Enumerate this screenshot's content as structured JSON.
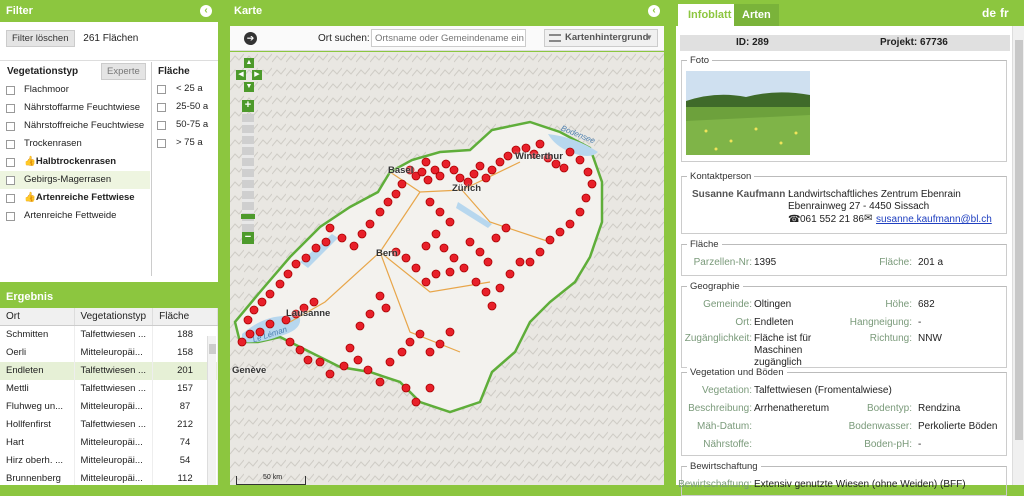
{
  "filter": {
    "title": "Filter",
    "clear_label": "Filter löschen",
    "count": "261 Flächen",
    "veg_header": "Vegetationstyp",
    "expert_label": "Experte",
    "area_header": "Fläche",
    "veg_items": [
      {
        "label": "Flachmoor"
      },
      {
        "label": "Nährstoffarme Feuchtwiese"
      },
      {
        "label": "Nährstoffreiche Feuchtwiese"
      },
      {
        "label": "Trockenrasen"
      },
      {
        "label": "Halbtrockenrasen"
      },
      {
        "label": "Gebirgs-Magerrasen"
      },
      {
        "label": "Artenreiche Fettwiese"
      },
      {
        "label": "Artenreiche Fettweide"
      }
    ],
    "area_items": [
      {
        "label": "< 25 a"
      },
      {
        "label": "25-50 a"
      },
      {
        "label": "50-75 a"
      },
      {
        "label": "> 75 a"
      }
    ]
  },
  "result": {
    "title": "Ergebnis",
    "columns": [
      "Ort",
      "Vegetationstyp",
      "Fläche"
    ],
    "rows": [
      {
        "ort": "Schmitten",
        "veg": "Talfettwiesen ...",
        "area": "188"
      },
      {
        "ort": "Oerli",
        "veg": "Mitteleuropäi...",
        "area": "158"
      },
      {
        "ort": "Endleten",
        "veg": "Talfettwiesen ...",
        "area": "201"
      },
      {
        "ort": "Mettli",
        "veg": "Talfettwiesen ...",
        "area": "157"
      },
      {
        "ort": "Fluhweg un...",
        "veg": "Mitteleuropäi...",
        "area": "87"
      },
      {
        "ort": "Hollfenfirst",
        "veg": "Talfettwiesen ...",
        "area": "212"
      },
      {
        "ort": "Hart",
        "veg": "Mitteleuropäi...",
        "area": "74"
      },
      {
        "ort": "Hirz oberh. ...",
        "veg": "Mitteleuropäi...",
        "area": "54"
      },
      {
        "ort": "Brunnenberg",
        "veg": "Mitteleuropäi...",
        "area": "112"
      }
    ]
  },
  "map": {
    "title": "Karte",
    "search_label": "Ort suchen:",
    "search_placeholder": "Ortsname oder Gemeindename ein",
    "bg_label": "Kartenhintergrund",
    "scale_label": "50 km",
    "lake_leman": "Le Léman",
    "lake_bodensee": "Bodensee",
    "cities": [
      {
        "name": "Basel"
      },
      {
        "name": "Winterthur"
      },
      {
        "name": "Zürich"
      },
      {
        "name": "Bern"
      },
      {
        "name": "Lausanne"
      },
      {
        "name": "Genève"
      }
    ]
  },
  "info": {
    "tab_info": "Infoblatt",
    "tab_species": "Arten",
    "lang_de": "de",
    "lang_fr": "fr",
    "id_label": "ID: 289",
    "project_label": "Projekt: 67736",
    "foto_title": "Foto",
    "contact_title": "Kontaktperson",
    "contact_name": "Susanne Kaufmann :",
    "contact_org": "Landwirtschaftliches Zentrum Ebenrain",
    "contact_addr": "Ebenrainweg 27 - 4450 Sissach",
    "phone": "061 552 21 86",
    "email": "susanne.kaufmann@bl.ch",
    "area_title": "Fläche",
    "parcel_label": "Parzellen-Nr:",
    "parcel_value": "1395",
    "flaeche_label": "Fläche:",
    "flaeche_value": "201 a",
    "geo_title": "Geographie",
    "gemeinde_label": "Gemeinde:",
    "gemeinde_value": "Oltingen",
    "hoehe_label": "Höhe:",
    "hoehe_value": "682",
    "ort_label": "Ort:",
    "ort_value": "Endleten",
    "neigung_label": "Hangneigung:",
    "neigung_value": "-",
    "zugang_label": "Zugänglichkeit:",
    "zugang_value": "Fläche ist für Maschinen zugänglich",
    "richtung_label": "Richtung:",
    "richtung_value": "NNW",
    "veg_title": "Vegetation und Böden",
    "vegetation_label": "Vegetation:",
    "vegetation_value": "Talfettwiesen (Fromentalwiese)",
    "beschreibung_label": "Beschreibung:",
    "beschreibung_value": "Arrhenatheretum",
    "bodentyp_label": "Bodentyp:",
    "bodentyp_value": "Rendzina",
    "mahd_label": "Mäh-Datum:",
    "bodenwasser_label": "Bodenwasser:",
    "bodenwasser_value": "Perkolierte Böden",
    "naehrstoffe_label": "Nährstoffe:",
    "bodenph_label": "Boden-pH:",
    "bodenph_value": "-",
    "bew_title": "Bewirtschaftung",
    "bew_label": "Bewirtschaftung:",
    "bew_value": "Extensiv genutzte Wiesen (ohne Weiden) (BFF)"
  },
  "colors": {
    "accent": "#8cc63f",
    "marker": "#e8202a"
  }
}
